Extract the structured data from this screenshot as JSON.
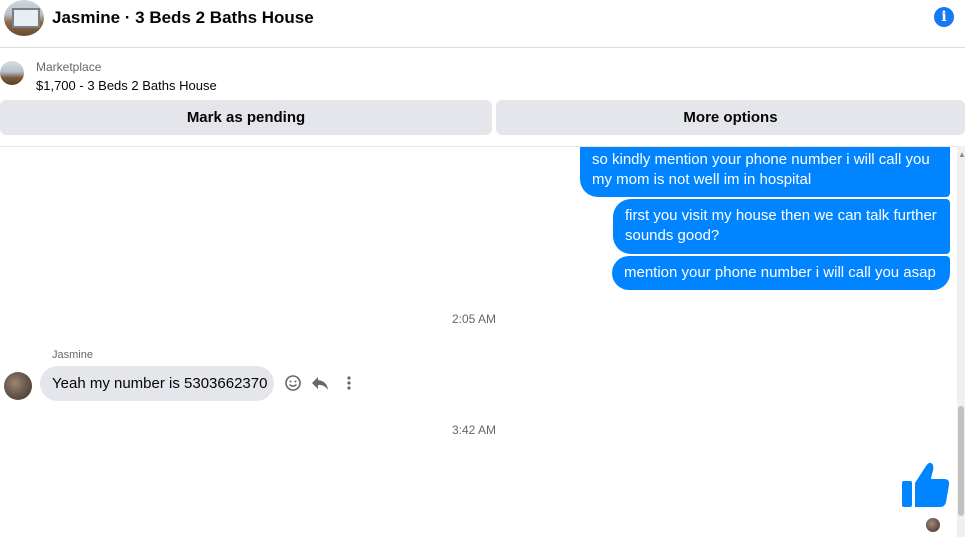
{
  "header": {
    "title": "Jasmine · 3 Beds 2 Baths House",
    "info_icon": "info-icon"
  },
  "marketplace": {
    "label": "Marketplace",
    "listing": "$1,700 - 3 Beds 2 Baths House"
  },
  "actions": {
    "pending": "Mark as pending",
    "more": "More options"
  },
  "messages_out": [
    {
      "line1": "so kindly mention your phone number i will call you",
      "line2": "my mom is not well im in hospital"
    },
    {
      "line1": "first you visit my house then we can talk further",
      "line2": "sounds good?"
    },
    {
      "line1": "mention your phone number i will call you asap"
    }
  ],
  "timestamps": [
    "2:05 AM",
    "3:42 AM"
  ],
  "incoming": {
    "sender": "Jasmine",
    "text": "Yeah my number is 5303662370"
  },
  "colors": {
    "outgoing_bubble": "#0084ff",
    "incoming_bubble": "#e4e6eb",
    "accent": "#1877f2"
  }
}
